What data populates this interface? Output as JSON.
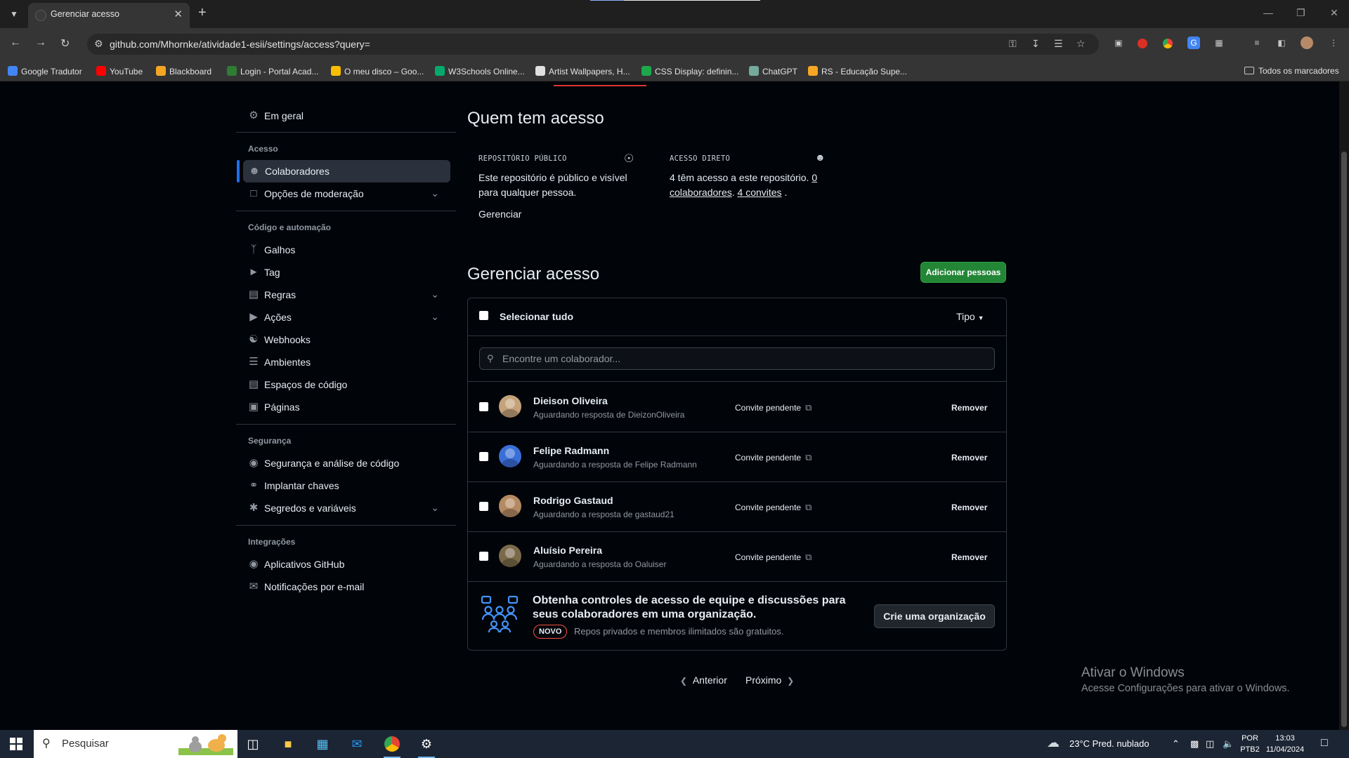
{
  "browser": {
    "tab_title": "Gerenciar acesso",
    "new_tab_symbol": "+",
    "url": "github.com/Mhornke/atividade1-esii/settings/access?query=",
    "bookmarks": [
      {
        "label": "Google Tradutor",
        "color": "#4285f4"
      },
      {
        "label": "YouTube",
        "color": "#ff0000"
      },
      {
        "label": "Blackboard",
        "color": "#f5a623"
      },
      {
        "label": "Login - Portal Acad...",
        "color": "#2e7d32"
      },
      {
        "label": "O meu disco – Goo...",
        "color": "#fbbc04"
      },
      {
        "label": "W3Schools Online...",
        "color": "#04aa6d"
      },
      {
        "label": "Artist Wallpapers, H...",
        "color": "#e0e0e0"
      },
      {
        "label": "CSS Display: definin...",
        "color": "#1ea84c"
      },
      {
        "label": "ChatGPT",
        "color": "#74aa9c"
      },
      {
        "label": "RS - Educação Supe...",
        "color": "#f5a623"
      }
    ],
    "all_bookmarks": "Todos os marcadores"
  },
  "sidebar": {
    "general": "Em geral",
    "sections": [
      {
        "heading": "Acesso",
        "items": [
          {
            "label": "Colaboradores",
            "icon": "person-icon",
            "active": true,
            "chevron": false
          },
          {
            "label": "Opções de moderação",
            "icon": "comment-icon",
            "active": false,
            "chevron": true
          }
        ]
      },
      {
        "heading": "Código e automação",
        "items": [
          {
            "label": "Galhos",
            "icon": "branch-icon",
            "chevron": false
          },
          {
            "label": "Tag",
            "icon": "tag-icon",
            "chevron": false
          },
          {
            "label": "Regras",
            "icon": "rules-icon",
            "chevron": true
          },
          {
            "label": "Ações",
            "icon": "play-icon",
            "chevron": true
          },
          {
            "label": "Webhooks",
            "icon": "webhook-icon",
            "chevron": false
          },
          {
            "label": "Ambientes",
            "icon": "server-icon",
            "chevron": false
          },
          {
            "label": "Espaços de código",
            "icon": "codespaces-icon",
            "chevron": false
          },
          {
            "label": "Páginas",
            "icon": "browser-icon",
            "chevron": false
          }
        ]
      },
      {
        "heading": "Segurança",
        "items": [
          {
            "label": "Segurança e análise de código",
            "icon": "codescan-icon",
            "chevron": false
          },
          {
            "label": "Implantar chaves",
            "icon": "key-icon",
            "chevron": false
          },
          {
            "label": "Segredos e variáveis",
            "icon": "asterisk-icon",
            "chevron": true
          }
        ]
      },
      {
        "heading": "Integrações",
        "items": [
          {
            "label": "Aplicativos GitHub",
            "icon": "apps-icon",
            "chevron": false
          },
          {
            "label": "Notificações por e-mail",
            "icon": "mail-icon",
            "chevron": false
          }
        ]
      }
    ]
  },
  "who": {
    "title": "Quem tem acesso",
    "public_label": "REPOSITÓRIO PÚBLICO",
    "public_text": "Este repositório é público e visível para qualquer pessoa.",
    "manage_link": "Gerenciar",
    "direct_label": "ACESSO DIRETO",
    "direct_text_pre": "4 têm acesso a este repositório.",
    "direct_collab_link": "0 colaboradores",
    "direct_sep": ".",
    "direct_invites_link": "4 convites",
    "direct_end": "."
  },
  "manage": {
    "title": "Gerenciar acesso",
    "add_button": "Adicionar pessoas",
    "select_all": "Selecionar tudo",
    "type_filter": "Tipo",
    "search_placeholder": "Encontre um colaborador...",
    "people": [
      {
        "name": "Dieison Oliveira",
        "sub": "Aguardando resposta de DieizonOliveira",
        "status": "Convite pendente",
        "action": "Remover",
        "avatar": "#c4a27a"
      },
      {
        "name": "Felipe Radmann",
        "sub": "Aguardando a resposta de Felipe Radmann",
        "status": "Convite pendente",
        "action": "Remover",
        "avatar": "#3a6fd8"
      },
      {
        "name": "Rodrigo Gastaud",
        "sub": "Aguardando a resposta de gastaud21",
        "status": "Convite pendente",
        "action": "Remover",
        "avatar": "#b48a62"
      },
      {
        "name": "Aluísio Pereira",
        "sub": "Aguardando a resposta do Oaluiser",
        "status": "Convite pendente",
        "action": "Remover",
        "avatar": "#7a6a4a"
      }
    ],
    "org_title": "Obtenha controles de acesso de equipe e discussões para seus colaboradores em uma organização.",
    "org_badge": "NOVO",
    "org_sub": "Repos privados e membros ilimitados são gratuitos.",
    "org_button": "Crie uma organização",
    "prev": "Anterior",
    "next": "Próximo"
  },
  "watermark": {
    "line1": "Ativar o Windows",
    "line2": "Acesse Configurações para ativar o Windows."
  },
  "taskbar": {
    "search_placeholder": "Pesquisar",
    "weather": "23°C  Pred. nublado",
    "lang1": "POR",
    "lang2": "PTB2",
    "time": "13:03",
    "date": "11/04/2024"
  }
}
